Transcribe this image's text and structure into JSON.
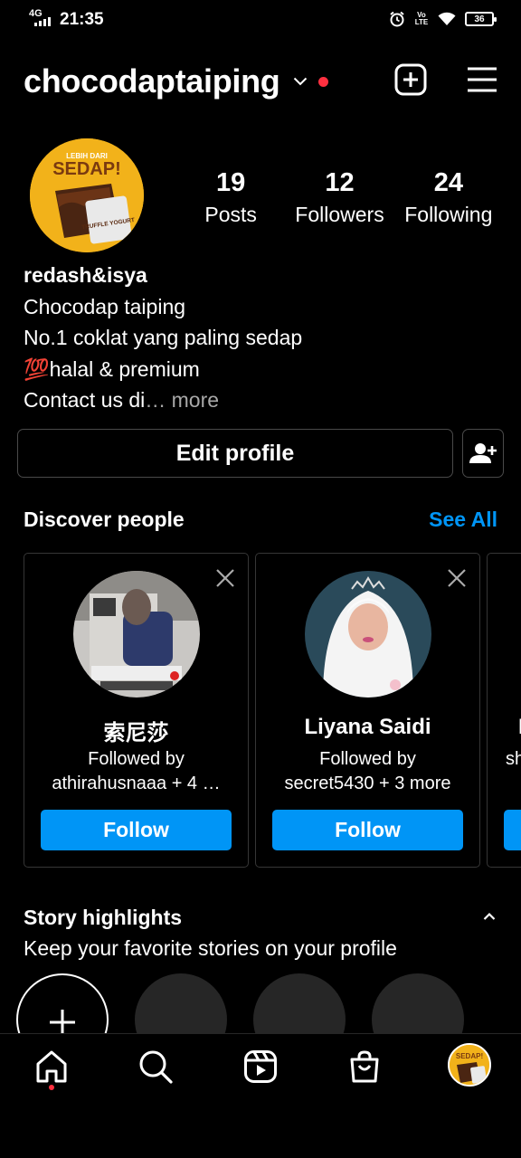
{
  "status_bar": {
    "network": "4G",
    "time": "21:35",
    "volte": "Vo LTE",
    "battery": "36",
    "icons": [
      "signal-icon",
      "alarm-icon",
      "volte-icon",
      "wifi-icon",
      "battery-icon"
    ]
  },
  "header": {
    "username": "chocodaptaiping",
    "icons": [
      "chevron-down-icon",
      "notification-dot",
      "create-post-icon",
      "menu-icon"
    ]
  },
  "profile": {
    "avatar_text_top": "LEBIH DARI",
    "avatar_text_main": "SEDAP!",
    "avatar_text_product": "TRUFFLE YOGURT",
    "stats": [
      {
        "value": "19",
        "label": "Posts"
      },
      {
        "value": "12",
        "label": "Followers"
      },
      {
        "value": "24",
        "label": "Following"
      }
    ],
    "bio": {
      "name": "redash&isya",
      "line1": "Chocodap taiping",
      "line2": "No.1 coklat yang paling sedap",
      "line3": "💯halal & premium",
      "line4": "Contact us di",
      "ellipsis": "…",
      "more": "more"
    }
  },
  "actions": {
    "edit_profile": "Edit profile",
    "add_person_icon": "add-person-icon"
  },
  "discover": {
    "title": "Discover people",
    "see_all": "See All",
    "cards": [
      {
        "name": "索尼莎",
        "followed_by_label": "Followed by",
        "followed_by": "athirahusnaaa + 4 …",
        "button": "Follow"
      },
      {
        "name": "Liyana Saidi",
        "followed_by_label": "Followed by",
        "followed_by": "secret5430 + 3 more",
        "button": "Follow"
      },
      {
        "name": "I",
        "followed_by_label": "",
        "followed_by": "sh",
        "button": ""
      }
    ]
  },
  "highlights": {
    "title": "Story highlights",
    "subtitle": "Keep your favorite stories on your profile"
  },
  "bottom_nav": {
    "items": [
      "home-icon",
      "search-icon",
      "reels-icon",
      "shop-icon",
      "profile-avatar"
    ],
    "profile_avatar_text": "SEDAP!"
  },
  "colors": {
    "background": "#000000",
    "accent_blue": "#0095f6",
    "notification_red": "#ff3040",
    "card_border": "#363636",
    "secondary_text": "#a8a8a8",
    "brand_yellow": "#f2b21a"
  }
}
